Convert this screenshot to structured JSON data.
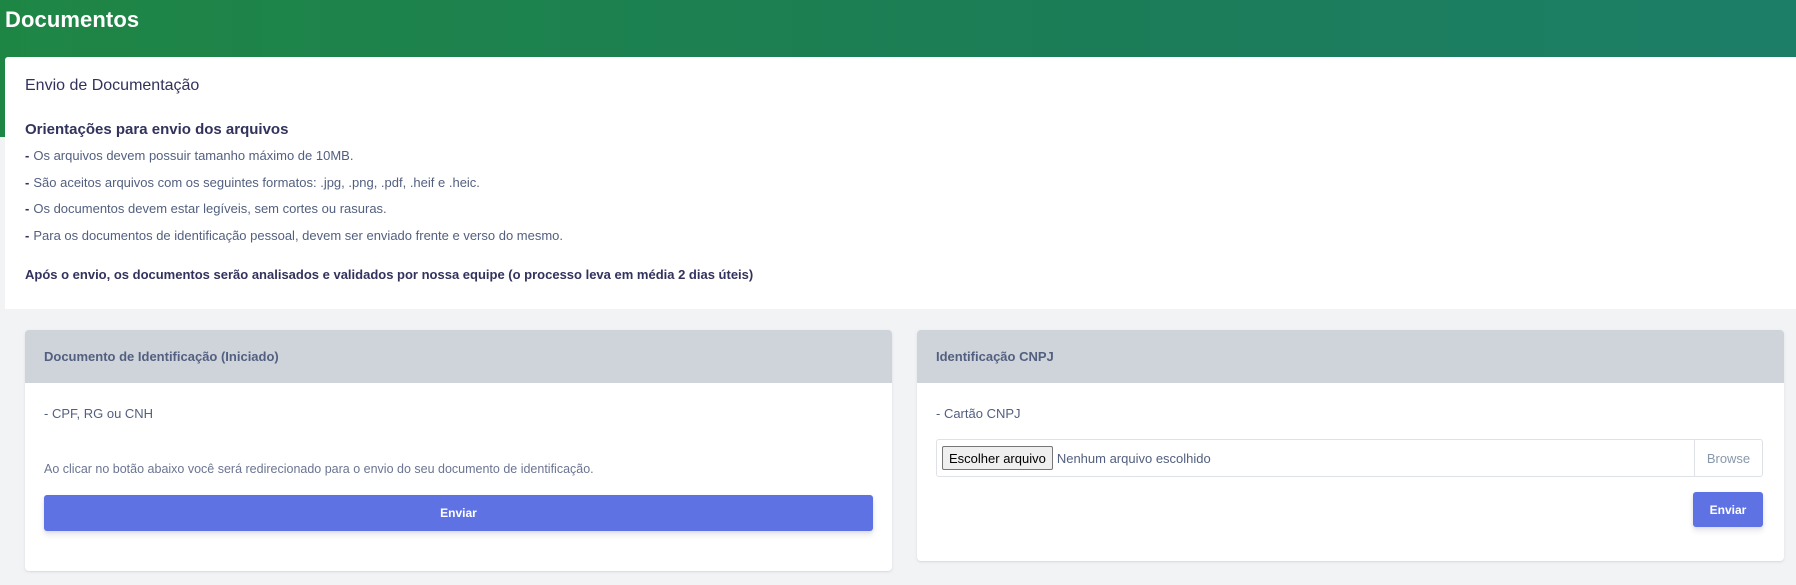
{
  "page": {
    "title": "Documentos"
  },
  "info": {
    "title": "Envio de Documentação",
    "guidelines_title": "Orientações para envio dos arquivos",
    "guidelines": [
      {
        "dash": "-",
        "text": "Os arquivos devem possuir tamanho máximo de 10MB."
      },
      {
        "dash": "-",
        "text": "São aceitos arquivos com os seguintes formatos: .jpg, .png, .pdf, .heif e .heic."
      },
      {
        "dash": "-",
        "text": "Os documentos devem estar legíveis, sem cortes ou rasuras."
      },
      {
        "dash": "-",
        "text": "Para os documentos de identificação pessoal, devem ser enviado frente e verso do mesmo."
      }
    ],
    "after_note": "Após o envio, os documentos serão analisados e validados por nossa equipe (o processo leva em média 2 dias úteis)"
  },
  "cards": {
    "identification": {
      "header": "Documento de Identificação  (Iniciado)",
      "subtitle": "- CPF, RG ou CNH",
      "note": "Ao clicar no botão abaixo você será redirecionado para o envio do seu documento de identificação.",
      "button_label": "Enviar"
    },
    "cnpj": {
      "header": "Identificação CNPJ",
      "subtitle": "- Cartão CNPJ",
      "file_choose_label": "Escolher arquivo",
      "file_status": "Nenhum arquivo escolhido",
      "browse_label": "Browse",
      "button_label": "Enviar"
    }
  },
  "colors": {
    "banner_start": "#1e8645",
    "banner_end": "#1c7e67",
    "primary_button": "#5e72e4",
    "card_header": "#cfd4db"
  }
}
